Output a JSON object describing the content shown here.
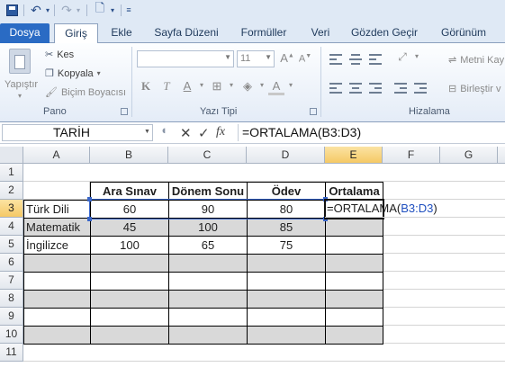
{
  "ribbon": {
    "tabs": [
      "Dosya",
      "Giriş",
      "Ekle",
      "Sayfa Düzeni",
      "Formüller",
      "Veri",
      "Gözden Geçir",
      "Görünüm"
    ],
    "clipboard": {
      "paste": "Yapıştır",
      "cut": "Kes",
      "copy": "Kopyala",
      "format_painter": "Biçim Boyacısı",
      "label": "Pano"
    },
    "font": {
      "size": "11",
      "bold": "K",
      "italic": "T",
      "underline": "A",
      "label": "Yazı Tipi"
    },
    "alignment": {
      "wrap": "Metni Kay",
      "merge": "Birleştir v",
      "label": "Hizalama"
    }
  },
  "formula_bar": {
    "name_box": "TARİH",
    "fx": "fx",
    "formula": "=ORTALAMA(B3:D3)"
  },
  "sheet": {
    "columns": [
      "A",
      "B",
      "C",
      "D",
      "E",
      "F",
      "G"
    ],
    "rows": [
      "1",
      "2",
      "3",
      "4",
      "5",
      "6",
      "7",
      "8",
      "9",
      "10",
      "11"
    ],
    "headers": {
      "b": "Ara Sınav",
      "c": "Dönem Sonu",
      "d": "Ödev",
      "e": "Ortalama"
    },
    "data": [
      {
        "name": "Türk Dili",
        "b": "60",
        "c": "90",
        "d": "80"
      },
      {
        "name": "Matematik",
        "b": "45",
        "c": "100",
        "d": "85"
      },
      {
        "name": "İngilizce",
        "b": "100",
        "c": "65",
        "d": "75"
      }
    ],
    "edit_prefix": "=ORTALAMA(",
    "edit_ref": "B3:D3",
    "edit_suffix": ")",
    "active_cell": "E3"
  }
}
